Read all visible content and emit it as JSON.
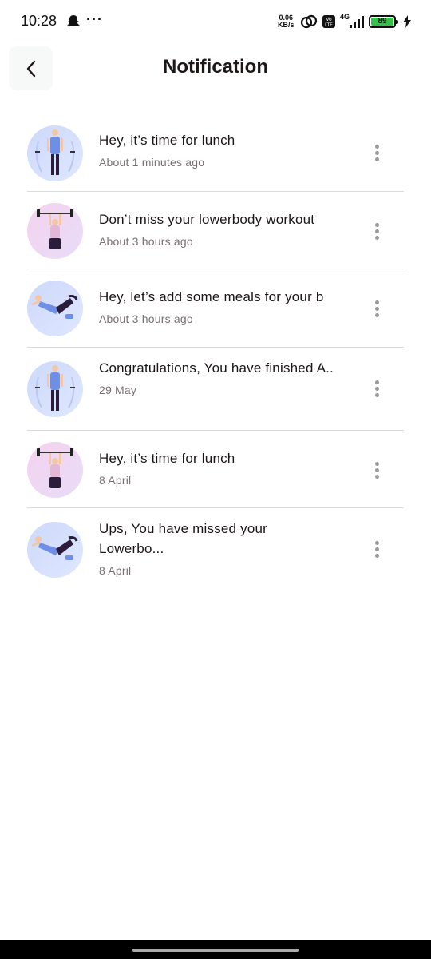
{
  "status_bar": {
    "time": "10:28",
    "speed_value": "0.06",
    "speed_unit": "KB/s",
    "network": "4G",
    "volte": "Vo LTE",
    "battery": "89"
  },
  "header": {
    "title": "Notification",
    "back_icon": "chevron-left-icon"
  },
  "notifications": [
    {
      "title": "Hey, it’s time for lunch",
      "time": "About 1 minutes ago",
      "avatar": "blue"
    },
    {
      "title": "Don’t miss your lowerbody workout",
      "time": "About 3 hours ago",
      "avatar": "pink"
    },
    {
      "title": "Hey, let’s add some meals for your b",
      "time": "About 3 hours ago",
      "avatar": "blue"
    },
    {
      "title": "Congratulations, You have finished A..",
      "time": "29 May",
      "avatar": "blue"
    },
    {
      "title": "Hey, it’s time for lunch",
      "time": "8 April",
      "avatar": "pink"
    },
    {
      "title": "Ups, You have missed your Lowerbo...",
      "time": "8 April",
      "avatar": "blue"
    }
  ],
  "colors": {
    "text_primary": "#1d1617",
    "text_secondary": "#7b6f72",
    "divider": "#dddada",
    "avatar_blue": "#cdd9fb",
    "avatar_pink": "#f4d3ee"
  }
}
